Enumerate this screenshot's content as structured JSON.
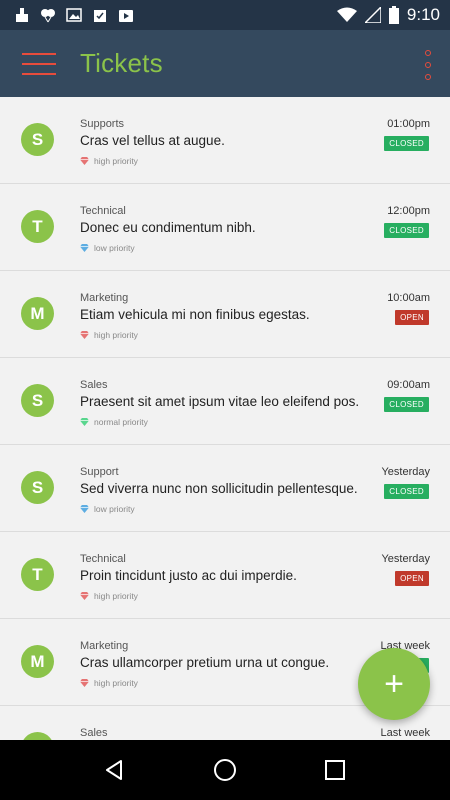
{
  "status_bar": {
    "time": "9:10",
    "left_icons": [
      "cleaner-icon",
      "balloons-icon",
      "image-icon",
      "clipboard-check-icon",
      "play-store-icon"
    ],
    "right_icons": [
      "wifi-icon",
      "signal-icon",
      "battery-icon"
    ]
  },
  "app_bar": {
    "title": "Tickets",
    "colors": {
      "background": "#34495e",
      "title": "#8bc34a",
      "icons": "#e74c3c"
    }
  },
  "tickets": [
    {
      "initial": "S",
      "category": "Supports",
      "subject": "Cras vel tellus at augue.",
      "priority": "high priority",
      "priority_color": "#e57373",
      "time": "01:00pm",
      "status": "CLOSED"
    },
    {
      "initial": "T",
      "category": "Technical",
      "subject": "Donec eu condimentum nibh.",
      "priority": "low priority",
      "priority_color": "#5dade2",
      "time": "12:00pm",
      "status": "CLOSED"
    },
    {
      "initial": "M",
      "category": "Marketing",
      "subject": "Etiam vehicula mi non finibus egestas.",
      "priority": "high priority",
      "priority_color": "#e57373",
      "time": "10:00am",
      "status": "OPEN"
    },
    {
      "initial": "S",
      "category": "Sales",
      "subject": "Praesent sit amet ipsum vitae leo eleifend pos...",
      "priority": "normal priority",
      "priority_color": "#58d68d",
      "time": "09:00am",
      "status": "CLOSED"
    },
    {
      "initial": "S",
      "category": "Support",
      "subject": "Sed viverra nunc non sollicitudin pellentesque.",
      "priority": "low priority",
      "priority_color": "#5dade2",
      "time": "Yesterday",
      "status": "CLOSED"
    },
    {
      "initial": "T",
      "category": "Technical",
      "subject": "Proin tincidunt justo ac dui imperdie.",
      "priority": "high priority",
      "priority_color": "#e57373",
      "time": "Yesterday",
      "status": "OPEN"
    },
    {
      "initial": "M",
      "category": "Marketing",
      "subject": "Cras ullamcorper pretium urna ut congue.",
      "priority": "high priority",
      "priority_color": "#e57373",
      "time": "Last week",
      "status": "CLOSED"
    },
    {
      "initial": "S",
      "category": "Sales",
      "subject": "",
      "priority": "",
      "priority_color": "#5dade2",
      "time": "Last week",
      "status": ""
    }
  ],
  "fab": {
    "label": "+"
  },
  "nav_bar": {
    "icons": [
      "back-icon",
      "home-icon",
      "recents-icon"
    ]
  }
}
